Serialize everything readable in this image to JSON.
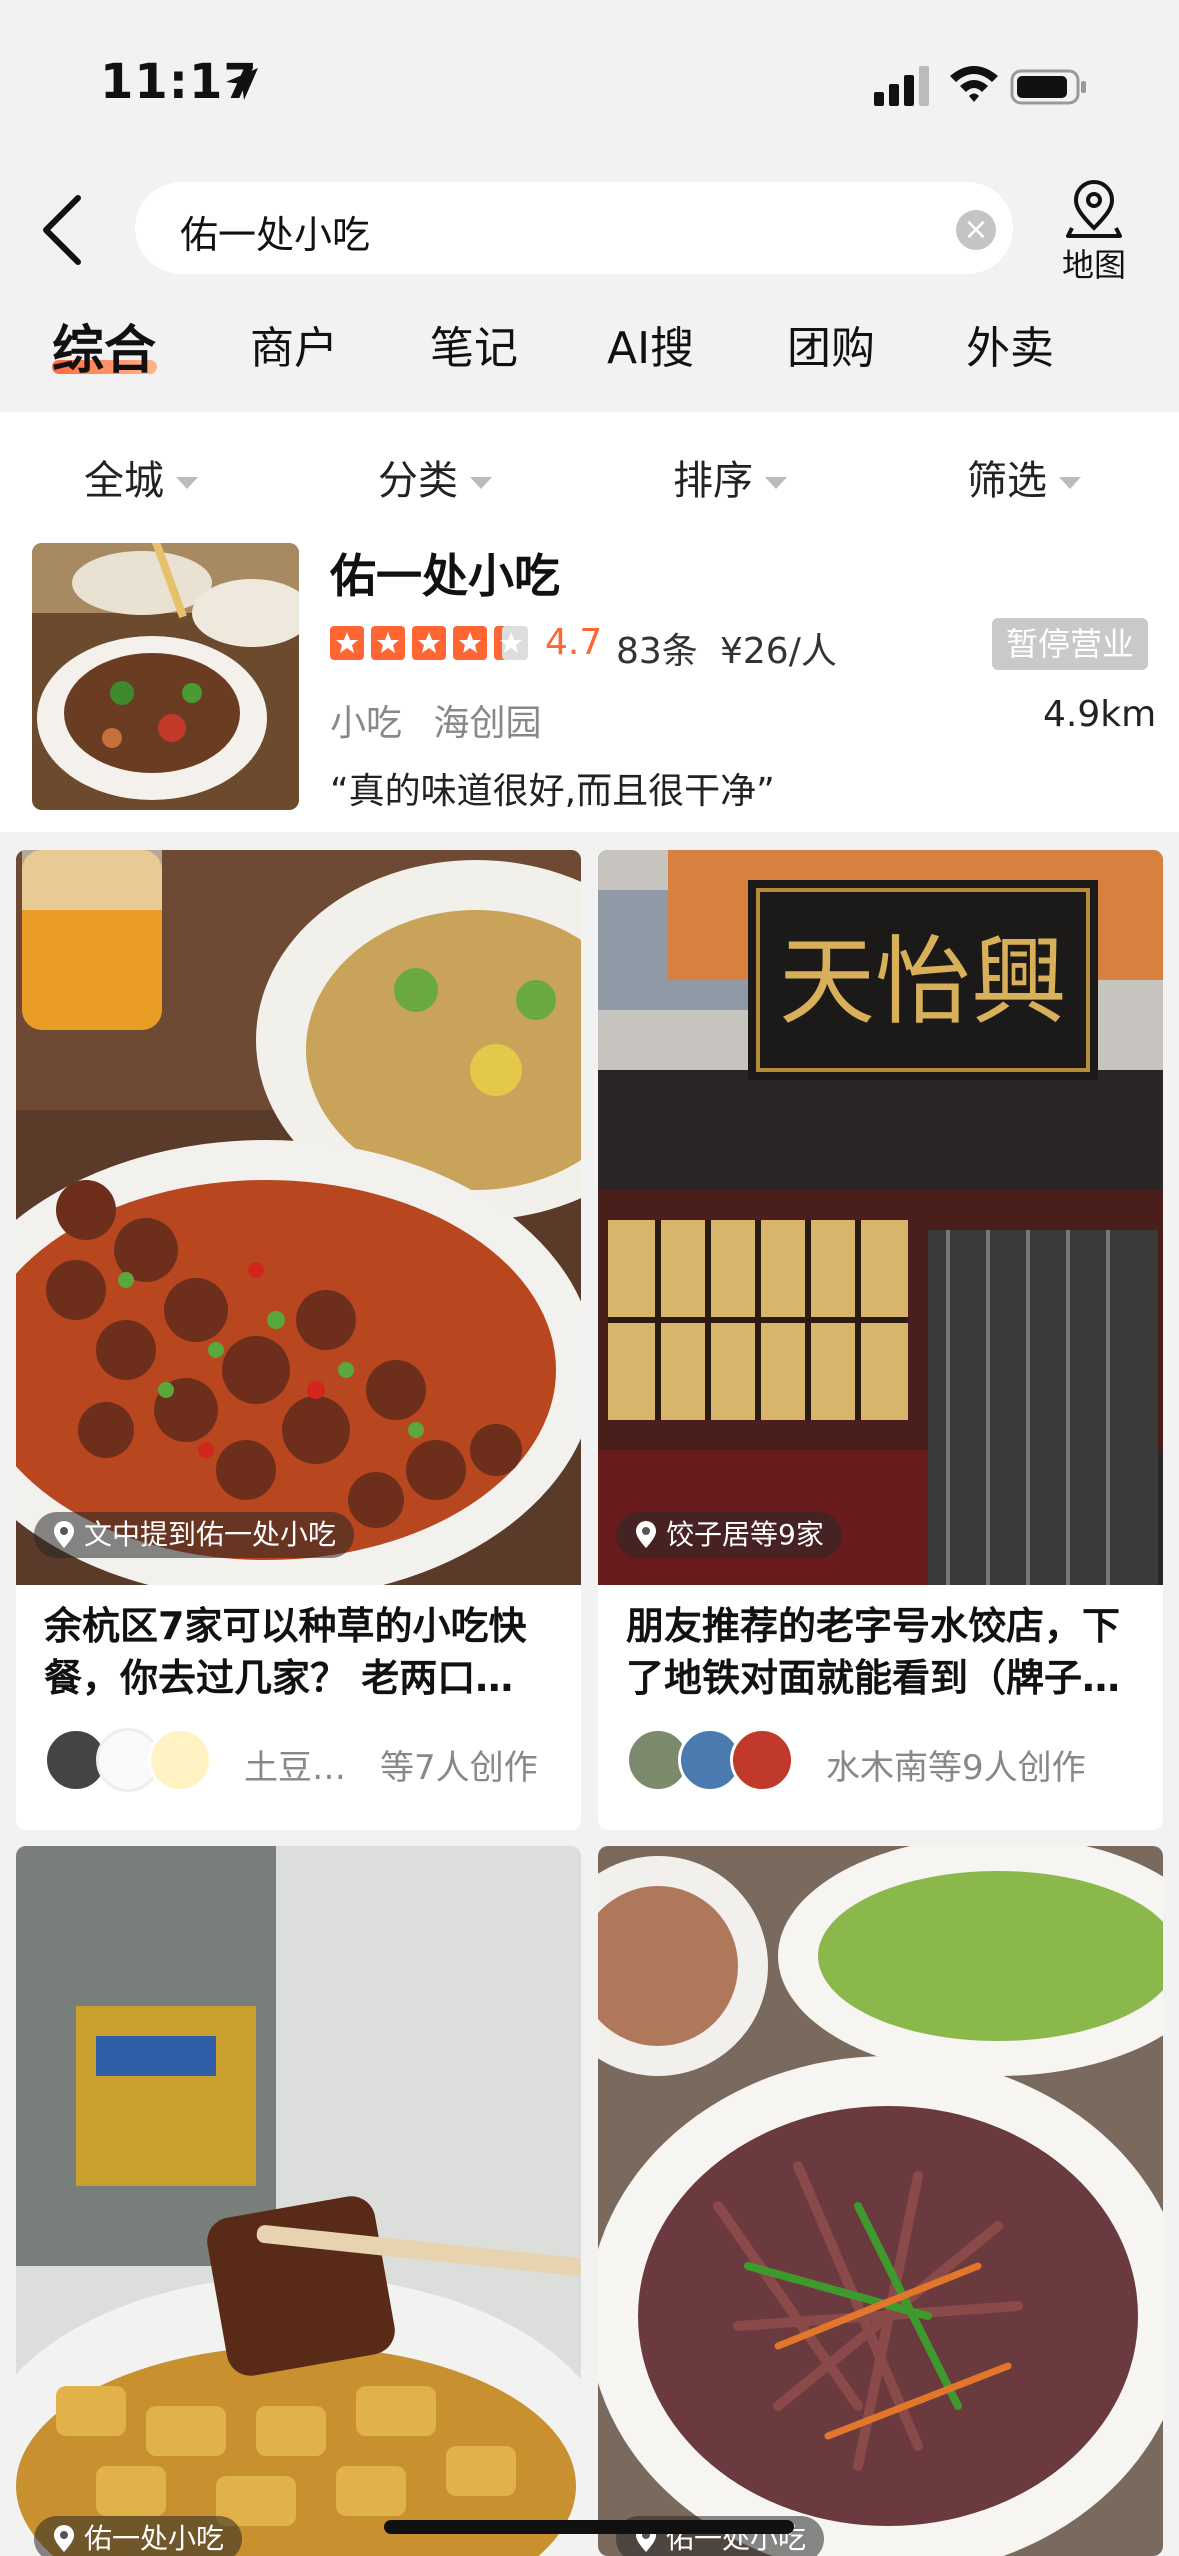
{
  "status_bar": {
    "time": "11:17"
  },
  "search": {
    "query": "佑一处小吃",
    "map_label": "地图"
  },
  "tabs": [
    {
      "label": "综合",
      "active": true
    },
    {
      "label": "商户"
    },
    {
      "label": "笔记"
    },
    {
      "label": "AI搜"
    },
    {
      "label": "团购"
    },
    {
      "label": "外卖"
    }
  ],
  "filters": [
    "全城",
    "分类",
    "排序",
    "筛选"
  ],
  "shop": {
    "name": "佑一处小吃",
    "rating": "4.7",
    "stars": 4.5,
    "reviews": "83条",
    "price": "¥26/人",
    "status": "暂停营业",
    "category": "小吃",
    "area": "海创园",
    "distance": "4.9km",
    "quote": "“真的味道很好,而且很干净”"
  },
  "notes": [
    {
      "location": "文中提到佑一处小吃",
      "title": "余杭区7家可以种草的小吃快餐，你去过几家？ 老两口…",
      "author": "土豆…",
      "creators": "等7人创作"
    },
    {
      "location": "饺子居等9家",
      "title": "朋友推荐的老字号水饺店，下了地铁对面就能看到（牌子…",
      "author": "",
      "creators": "水木南等9人创作"
    },
    {
      "location": "佑一处小吃"
    },
    {
      "location": "佑一处小吃"
    }
  ],
  "sign_text": "天怡興",
  "colors": {
    "accent": "#ff6633",
    "badge": "#c9c9c9"
  }
}
